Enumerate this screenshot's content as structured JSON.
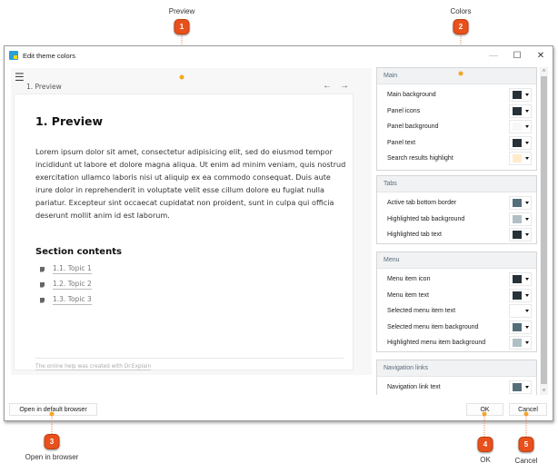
{
  "callouts": [
    {
      "number": "1",
      "label": "Preview"
    },
    {
      "number": "2",
      "label": "Colors"
    },
    {
      "number": "3",
      "label": "Open in browser"
    },
    {
      "number": "4",
      "label": "OK"
    },
    {
      "number": "5",
      "label": "Cancel"
    }
  ],
  "window": {
    "title": "Edit theme colors",
    "controls": {
      "minimize": "—",
      "maximize": "☐",
      "close": "✕"
    }
  },
  "preview": {
    "menu_icon": "☰",
    "breadcrumb": "1. Preview",
    "nav_prev": "←",
    "nav_next": "→",
    "title": "1. Preview",
    "body": "Lorem ipsum dolor sit amet, consectetur adipisicing elit, sed do eiusmod tempor incididunt ut labore et dolore magna aliqua. Ut enim ad minim veniam, quis nostrud exercitation ullamco laboris nisi ut aliquip ex ea commodo consequat. Duis aute irure dolor in reprehenderit in voluptate velit esse cillum dolore eu fugiat nulla pariatur. Excepteur sint occaecat cupidatat non proident, sunt in culpa qui officia deserunt mollit anim id est laborum.",
    "section_title": "Section contents",
    "topics": [
      "1.1. Topic 1",
      "1.2. Topic 2",
      "1.3. Topic 3"
    ],
    "footer": "The online help was created with Dr.Explain"
  },
  "colors": {
    "groups": [
      {
        "title": "Main",
        "rows": [
          {
            "label": "Main background",
            "color": "#263238"
          },
          {
            "label": "Panel icons",
            "color": "#263238"
          },
          {
            "label": "Panel background",
            "color": "#f7f7f7"
          },
          {
            "label": "Panel text",
            "color": "#263238"
          },
          {
            "label": "Search results highlight",
            "color": "#ffebcc"
          }
        ]
      },
      {
        "title": "Tabs",
        "rows": [
          {
            "label": "Active tab bottom border",
            "color": "#546e7a"
          },
          {
            "label": "Highlighted tab background",
            "color": "#b0bec5"
          },
          {
            "label": "Highlighted tab text",
            "color": "#263238"
          }
        ]
      },
      {
        "title": "Menu",
        "rows": [
          {
            "label": "Menu item icon",
            "color": "#263238"
          },
          {
            "label": "Menu item text",
            "color": "#263238"
          },
          {
            "label": "Selected menu item text",
            "color": "#ffffff"
          },
          {
            "label": "Selected menu item background",
            "color": "#546e7a"
          },
          {
            "label": "Highlighted menu item background",
            "color": "#b0bec5"
          }
        ]
      },
      {
        "title": "Navigation links",
        "rows": [
          {
            "label": "Navigation link text",
            "color": "#546e7a"
          }
        ]
      }
    ]
  },
  "scrollbar": {
    "up": "˄",
    "down": "˅"
  },
  "buttons": {
    "open_browser": "Open in default browser",
    "ok": "OK",
    "cancel": "Cancel"
  }
}
